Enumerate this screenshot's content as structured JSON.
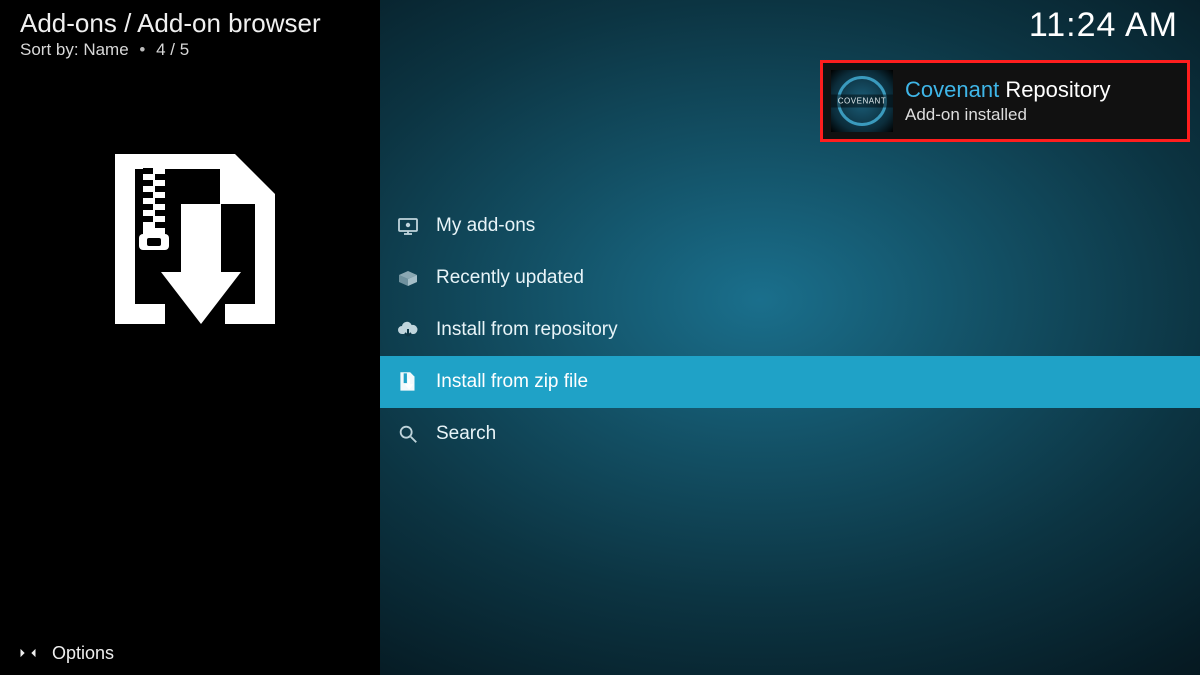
{
  "header": {
    "breadcrumb": "Add-ons / Add-on browser",
    "sort_prefix": "Sort by:",
    "sort_value": "Name",
    "counter": "4 / 5",
    "clock": "11:24 AM"
  },
  "menu": {
    "items": [
      {
        "icon": "monitor-icon",
        "label": "My add-ons",
        "selected": false
      },
      {
        "icon": "box-open-icon",
        "label": "Recently updated",
        "selected": false
      },
      {
        "icon": "cloud-down-icon",
        "label": "Install from repository",
        "selected": false
      },
      {
        "icon": "zip-down-icon",
        "label": "Install from zip file",
        "selected": true
      },
      {
        "icon": "search-icon",
        "label": "Search",
        "selected": false
      }
    ]
  },
  "options": {
    "label": "Options"
  },
  "toast": {
    "thumb_text": "COVENANT",
    "title_accent": "Covenant",
    "title_rest": "Repository",
    "subtitle": "Add-on installed"
  }
}
